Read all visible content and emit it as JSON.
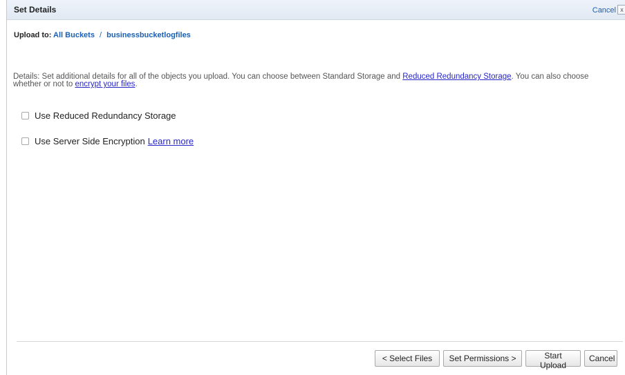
{
  "header": {
    "title": "Set Details",
    "cancel_label": "Cancel",
    "close_label": "x"
  },
  "breadcrumb": {
    "prefix": "Upload to:",
    "root": "All Buckets",
    "separator": "/",
    "bucket": "businessbucketlogfiles"
  },
  "details": {
    "text_1": "Details: Set additional details for all of the objects you upload. You can choose between Standard Storage and ",
    "link_1": "Reduced Redundancy Storage",
    "text_2": ". You can also choose whether or not to ",
    "link_2": "encrypt your files",
    "text_3": "."
  },
  "options": {
    "rrs_label": "Use Reduced Redundancy Storage",
    "rrs_checked": false,
    "sse_label": "Use Server Side Encryption",
    "sse_checked": false,
    "learn_more": "Learn more"
  },
  "footer": {
    "select_files": "< Select Files",
    "set_permissions": "Set Permissions >",
    "start_upload": "Start Upload",
    "cancel": "Cancel"
  }
}
